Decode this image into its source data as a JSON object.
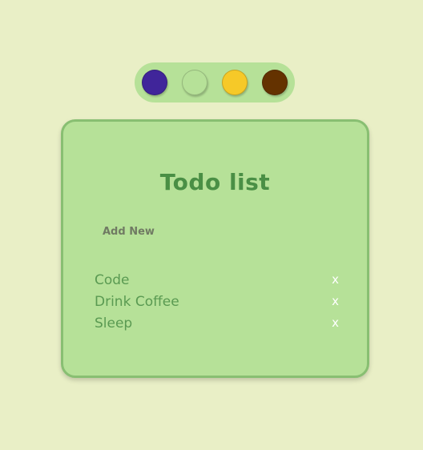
{
  "theme_picker": {
    "swatches": [
      {
        "name": "purple",
        "color": "#40259a"
      },
      {
        "name": "light-green",
        "color": "#b6e198"
      },
      {
        "name": "yellow",
        "color": "#f6c928"
      },
      {
        "name": "brown",
        "color": "#643200"
      }
    ]
  },
  "card": {
    "title": "Todo list",
    "add_new_label": "Add New",
    "todos": [
      {
        "text": "Code",
        "delete_label": "x"
      },
      {
        "text": "Drink Coffee",
        "delete_label": "x"
      },
      {
        "text": "Sleep",
        "delete_label": "x"
      }
    ]
  },
  "colors": {
    "page_background": "#e9efc6",
    "card_background": "#b6e198",
    "card_border": "#88bf72",
    "title": "#4a8f45",
    "todo_text": "#5a9a52",
    "add_new_text": "#707a63",
    "delete_icon": "#ffffff"
  }
}
